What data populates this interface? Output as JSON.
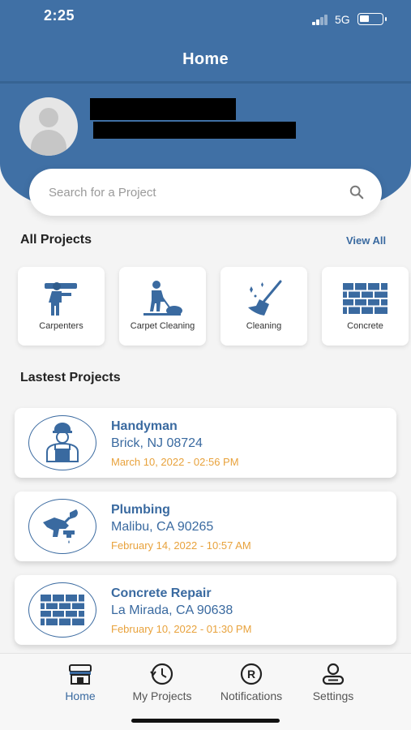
{
  "status_bar": {
    "time": "2:25",
    "network": "5G"
  },
  "header": {
    "title": "Home"
  },
  "search": {
    "placeholder": "Search for a Project"
  },
  "all_projects": {
    "title": "All Projects",
    "view_all": "View All",
    "categories": [
      {
        "label": "Carpenters",
        "icon": "carpenter-icon"
      },
      {
        "label": "Carpet Cleaning",
        "icon": "carpet-cleaning-icon"
      },
      {
        "label": "Cleaning",
        "icon": "broom-icon"
      },
      {
        "label": "Concrete",
        "icon": "brick-wall-icon"
      }
    ]
  },
  "latest_projects": {
    "title": "Lastest Projects",
    "items": [
      {
        "title": "Handyman",
        "location": "Brick, NJ 08724",
        "date": "March 10, 2022 - 02:56 PM",
        "icon": "handyman-icon"
      },
      {
        "title": "Plumbing",
        "location": "Malibu, CA 90265",
        "date": "February 14, 2022 - 10:57 AM",
        "icon": "plumbing-icon"
      },
      {
        "title": "Concrete Repair",
        "location": "La Mirada, CA 90638",
        "date": "February 10, 2022 - 01:30 PM",
        "icon": "brick-wall-icon"
      }
    ]
  },
  "tabs": [
    {
      "label": "Home",
      "icon": "store-icon",
      "active": true
    },
    {
      "label": "My Projects",
      "icon": "history-clock-icon",
      "active": false
    },
    {
      "label": "Notifications",
      "icon": "registered-icon",
      "active": false
    },
    {
      "label": "Settings",
      "icon": "user-settings-icon",
      "active": false
    }
  ],
  "colors": {
    "primary": "#4070a5",
    "accent_text": "#3a6aa0",
    "date": "#e8a23c",
    "background": "#f4f4f4"
  }
}
